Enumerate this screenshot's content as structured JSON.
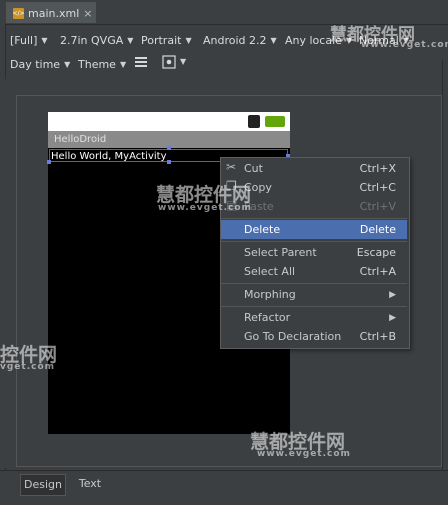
{
  "editor_tab": {
    "filename": "main.xml",
    "close": "×"
  },
  "toolbar1": {
    "screen_size": "[Full]",
    "device": "2.7in QVGA",
    "orientation": "Portrait",
    "api": "Android 2.2",
    "locale": "Any locale",
    "mode": "Normal"
  },
  "toolbar2": {
    "day_time": "Day time",
    "theme": "Theme"
  },
  "device_preview": {
    "app_title": "HelloDroid",
    "text_view": "Hello World, MyActivity"
  },
  "context_menu": {
    "cut": {
      "label": "Cut",
      "shortcut": "Ctrl+X"
    },
    "copy": {
      "label": "Copy",
      "shortcut": "Ctrl+C"
    },
    "paste": {
      "label": "Paste",
      "shortcut": "Ctrl+V"
    },
    "delete": {
      "label": "Delete",
      "shortcut": "Delete"
    },
    "select_parent": {
      "label": "Select Parent",
      "shortcut": "Escape"
    },
    "select_all": {
      "label": "Select All",
      "shortcut": "Ctrl+A"
    },
    "morphing": {
      "label": "Morphing"
    },
    "refactor": {
      "label": "Refactor"
    },
    "go_to_declaration": {
      "label": "Go To Declaration",
      "shortcut": "Ctrl+B"
    }
  },
  "bottom_tabs": {
    "design": "Design",
    "text": "Text"
  },
  "watermarks": {
    "brand": "慧都控件网",
    "url": "www.evget.com",
    "left_brand": "控件网",
    "left_url": "vget.com"
  },
  "colors": {
    "selection": "#4b6eaf",
    "battery": "#63a60c",
    "background": "#3c3f41"
  }
}
